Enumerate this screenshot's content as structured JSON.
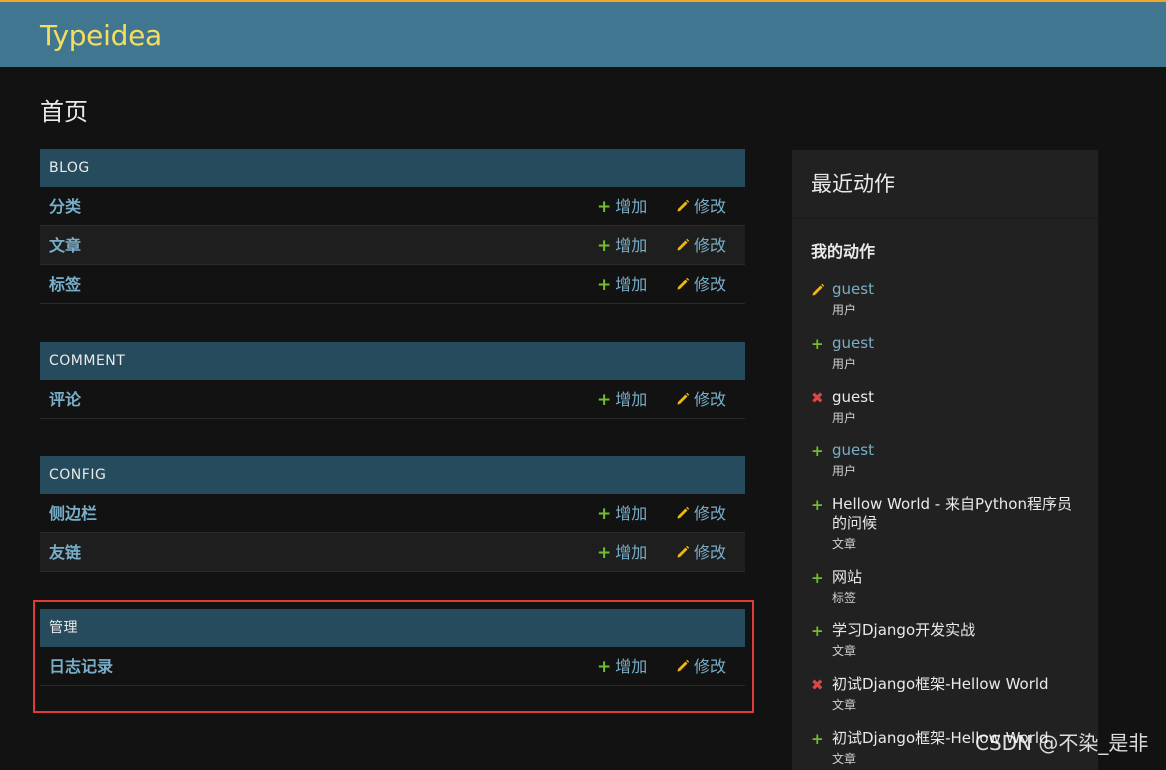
{
  "header": {
    "brand": "Typeidea"
  },
  "page": {
    "title": "首页"
  },
  "actions": {
    "add_label": "增加",
    "change_label": "修改"
  },
  "modules": [
    {
      "name": "BLOG",
      "models": [
        "分类",
        "文章",
        "标签"
      ]
    },
    {
      "name": "COMMENT",
      "models": [
        "评论"
      ]
    },
    {
      "name": "CONFIG",
      "models": [
        "侧边栏",
        "友链"
      ]
    },
    {
      "name": "管理",
      "models": [
        "日志记录"
      ]
    }
  ],
  "recent": {
    "title": "最近动作",
    "subtitle": "我的动作",
    "items": [
      {
        "kind": "change",
        "title": "guest",
        "type": "用户"
      },
      {
        "kind": "add",
        "title": "guest",
        "type": "用户"
      },
      {
        "kind": "delete",
        "title": "guest",
        "type": "用户"
      },
      {
        "kind": "add",
        "title": "guest",
        "type": "用户"
      },
      {
        "kind": "add",
        "title": "Hellow World - 来自Python程序员的问候",
        "type": "文章"
      },
      {
        "kind": "add",
        "title": "网站",
        "type": "标签"
      },
      {
        "kind": "add",
        "title": "学习Django开发实战",
        "type": "文章"
      },
      {
        "kind": "delete",
        "title": "初试Django框架-Hellow World",
        "type": "文章"
      },
      {
        "kind": "add",
        "title": "初试Django框架-Hellow World",
        "type": "文章"
      }
    ]
  },
  "colors": {
    "header_bg": "#417690",
    "module_header_bg": "#264b5d",
    "link": "#79aec8",
    "brand": "#f5dd5d",
    "add_icon": "#70bf2b",
    "delete_icon": "#dd4646",
    "change_icon": "#efb80b",
    "highlight_border": "#e03a3a"
  },
  "watermark": "CSDN @不染_是非"
}
